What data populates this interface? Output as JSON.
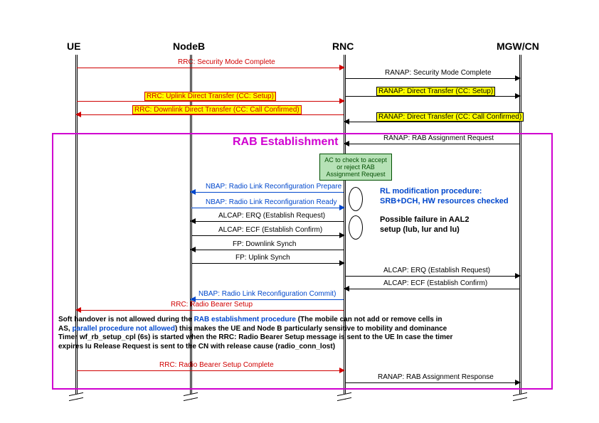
{
  "actors": {
    "ue": "UE",
    "nodeb": "NodeB",
    "rnc": "RNC",
    "mgwcn": "MGW/CN"
  },
  "rab_title": "RAB Establishment",
  "green_box": {
    "l1": "AC to check to accept",
    "l2": "or reject RAB",
    "l3": "Assignment Request"
  },
  "msg": {
    "rrc_smc": "RRC: Security Mode Complete",
    "ranap_smc": "RANAP: Security Mode Complete",
    "rrc_udt": "RRC: Uplink Direct Transfer (CC: Setup)",
    "ranap_dt_setup": "RANAP: Direct Transfer (CC: Setup)",
    "rrc_ddt": "RRC: Downlink Direct Transfer (CC: Call Confirmed)",
    "ranap_dt_cc": "RANAP: Direct Transfer (CC: Call Confirmed)",
    "ranap_rar": "RANAP: RAB Assignment Request",
    "nbap_prep": "NBAP: Radio Link Reconfiguration Prepare",
    "nbap_ready": "NBAP: Radio Link Reconfiguration Ready",
    "alcap_erq": "ALCAP: ERQ (Establish Request)",
    "alcap_ecf": "ALCAP: ECF (Establish Confirm)",
    "fp_dl": "FP:  Downlink Synch",
    "fp_ul": "FP:  Uplink Synch",
    "alcap_erq2": "ALCAP: ERQ (Establish Request)",
    "alcap_ecf2": "ALCAP: ECF (Establish Confirm)",
    "nbap_commit": "NBAP: Radio Link Reconfiguration Commit)",
    "rrc_rbs": "RRC: Radio Bearer Setup",
    "rrc_rbsc": "RRC: Radio Bearer Setup Complete",
    "ranap_resp": "RANAP: RAB Assignment Response"
  },
  "annot": {
    "rl_l1": "RL modification procedure:",
    "rl_l2": "SRB+DCH, HW resources checked",
    "aal2_l1": "Possible failure in AAL2",
    "aal2_l2": "setup  (lub, lur and lu)"
  },
  "note": {
    "t1a": "Soft handover is not allowed during the ",
    "t1b": "RAB establishment procedure",
    "t1c": " (The mobile can not add or remove cells in",
    "t2a": "AS, ",
    "t2b": "parallel procedure not allowed",
    "t2c": ") this makes the UE and Node B particularly sensitive to mobility and dominance",
    "t3": "Timer wf_rb_setup_cpl (6s) is started when the RRC: Radio Bearer Setup message is sent to the UE In case the timer",
    "t4": "expires Iu Release Request is sent to the CN with release cause (radio_conn_lost)"
  },
  "chart_data": {
    "type": "sequence-diagram",
    "actors": [
      "UE",
      "NodeB",
      "RNC",
      "MGW/CN"
    ],
    "messages": [
      {
        "from": "UE",
        "to": "RNC",
        "label": "RRC: Security Mode Complete",
        "color": "red"
      },
      {
        "from": "RNC",
        "to": "MGW/CN",
        "label": "RANAP: Security Mode Complete",
        "color": "black"
      },
      {
        "from": "UE",
        "to": "RNC",
        "label": "RRC: Uplink Direct Transfer (CC: Setup)",
        "color": "red",
        "highlight": true
      },
      {
        "from": "RNC",
        "to": "MGW/CN",
        "label": "RANAP: Direct Transfer (CC: Setup)",
        "color": "black",
        "highlight": true
      },
      {
        "from": "RNC",
        "to": "UE",
        "label": "RRC: Downlink Direct Transfer (CC: Call Confirmed)",
        "color": "red",
        "highlight": true
      },
      {
        "from": "MGW/CN",
        "to": "RNC",
        "label": "RANAP: Direct Transfer (CC: Call Confirmed)",
        "color": "black",
        "highlight": true
      },
      {
        "from": "MGW/CN",
        "to": "RNC",
        "label": "RANAP: RAB Assignment Request",
        "color": "black"
      },
      {
        "note": "AC to check to accept or reject RAB Assignment Request",
        "at": "RNC"
      },
      {
        "from": "RNC",
        "to": "NodeB",
        "label": "NBAP: Radio Link Reconfiguration Prepare",
        "color": "blue"
      },
      {
        "from": "NodeB",
        "to": "RNC",
        "label": "NBAP: Radio Link Reconfiguration Ready",
        "color": "blue"
      },
      {
        "from": "RNC",
        "to": "NodeB",
        "label": "ALCAP: ERQ (Establish Request)",
        "color": "black"
      },
      {
        "from": "NodeB",
        "to": "RNC",
        "label": "ALCAP: ECF (Establish Confirm)",
        "color": "black"
      },
      {
        "from": "RNC",
        "to": "NodeB",
        "label": "FP: Downlink Synch",
        "color": "black"
      },
      {
        "from": "NodeB",
        "to": "RNC",
        "label": "FP: Uplink Synch",
        "color": "black"
      },
      {
        "from": "RNC",
        "to": "MGW/CN",
        "label": "ALCAP: ERQ (Establish Request)",
        "color": "black"
      },
      {
        "from": "MGW/CN",
        "to": "RNC",
        "label": "ALCAP: ECF (Establish Confirm)",
        "color": "black"
      },
      {
        "from": "RNC",
        "to": "NodeB",
        "label": "NBAP: Radio Link Reconfiguration Commit)",
        "color": "blue"
      },
      {
        "from": "RNC",
        "to": "UE",
        "label": "RRC: Radio Bearer Setup",
        "color": "red"
      },
      {
        "from": "UE",
        "to": "RNC",
        "label": "RRC: Radio Bearer Setup Complete",
        "color": "red"
      },
      {
        "from": "RNC",
        "to": "MGW/CN",
        "label": "RANAP: RAB Assignment Response",
        "color": "black"
      }
    ]
  }
}
